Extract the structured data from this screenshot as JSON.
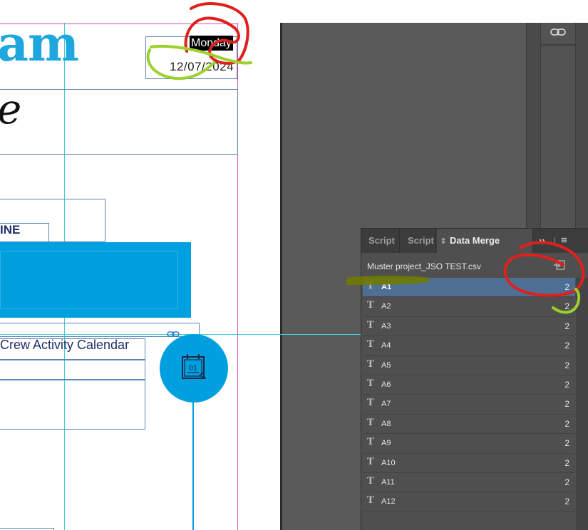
{
  "document": {
    "headline_fragment": "am",
    "script_glyph": "e",
    "day": "Monday",
    "date": "12/07/2024",
    "inline_label": "INE",
    "calendar_title": "Crew Activity Calendar",
    "calendar_icon_number": "01"
  },
  "panel": {
    "tabs": [
      {
        "label": "Script"
      },
      {
        "label": "Script"
      },
      {
        "label": "Data Merge"
      }
    ],
    "overflow_icon": "double-chevron-right-icon",
    "menu_icon": "hamburger-menu-icon",
    "data_source": "Muster project_JSO TEST.csv",
    "fields": [
      {
        "type": "T",
        "name": "A1",
        "value": "2",
        "selected": true
      },
      {
        "type": "T",
        "name": "A2",
        "value": "2"
      },
      {
        "type": "T",
        "name": "A3",
        "value": "2"
      },
      {
        "type": "T",
        "name": "A4",
        "value": "2"
      },
      {
        "type": "T",
        "name": "A5",
        "value": "2"
      },
      {
        "type": "T",
        "name": "A6",
        "value": "2"
      },
      {
        "type": "T",
        "name": "A7",
        "value": "2"
      },
      {
        "type": "T",
        "name": "A8",
        "value": "2"
      },
      {
        "type": "T",
        "name": "A9",
        "value": "2"
      },
      {
        "type": "T",
        "name": "A10",
        "value": "2"
      },
      {
        "type": "T",
        "name": "A11",
        "value": "2"
      },
      {
        "type": "T",
        "name": "A12",
        "value": "2"
      }
    ]
  },
  "colors": {
    "accent_blue": "#009fdf",
    "selection_row": "#4d6f94",
    "annotation_red": "#e0201c",
    "annotation_green": "#9bd12a",
    "annotation_olive": "#6f7a00"
  }
}
